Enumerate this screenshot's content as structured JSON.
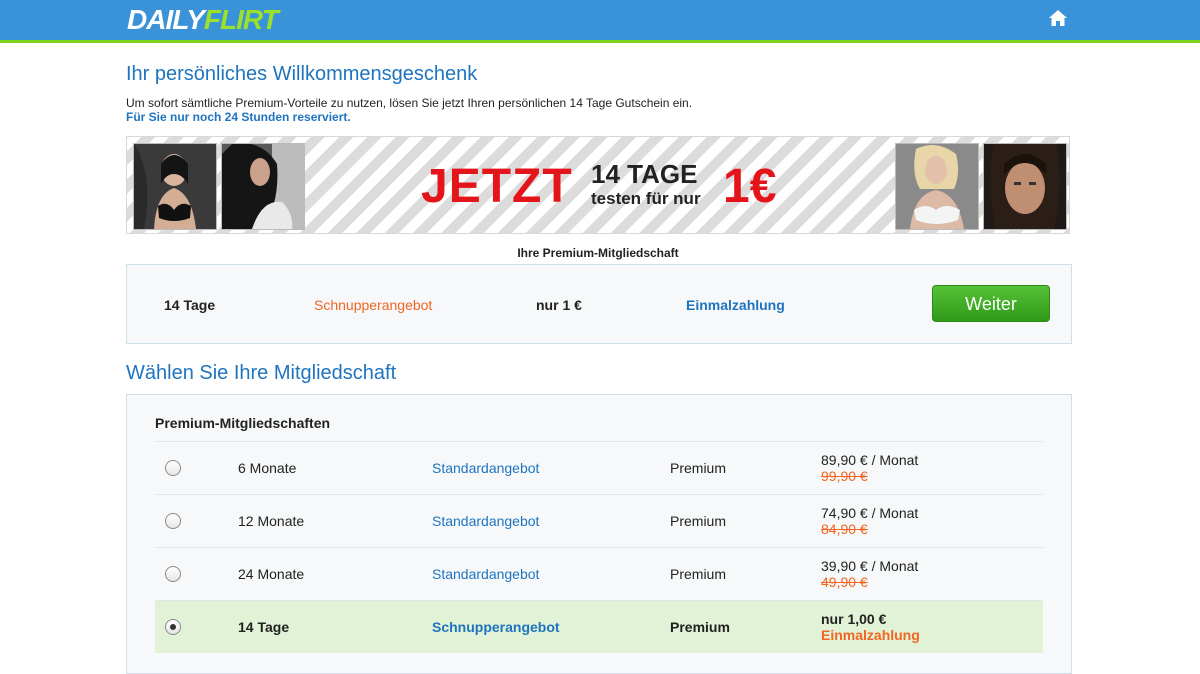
{
  "header": {
    "logo_part1": "DAILY",
    "logo_part2": "FLIRT",
    "home_icon": "home-icon",
    "brand_color": "#3a92d8",
    "accent_color": "#7ed321"
  },
  "welcome": {
    "title": "Ihr persönliches Willkommensgeschenk",
    "text": "Um sofort sämtliche Premium-Vorteile zu nutzen, lösen Sie jetzt Ihren persönlichen 14 Tage Gutschein ein.",
    "reserved": "Für Sie nur noch 24 Stunden reserviert."
  },
  "banner": {
    "jetzt": "JETZT",
    "tage": "14 TAGE",
    "testen": "testen für nur",
    "price": "1€"
  },
  "selected": {
    "section_label": "Ihre Premium-Mitgliedschaft",
    "duration": "14 Tage",
    "offer": "Schnupperangebot",
    "price": "nur 1 €",
    "payment": "Einmalzahlung",
    "button": "Weiter"
  },
  "plans": {
    "title": "Wählen Sie Ihre Mitgliedschaft",
    "subtitle": "Premium-Mitgliedschaften",
    "rows": [
      {
        "duration": "6 Monate",
        "offer": "Standardangebot",
        "type": "Premium",
        "price": "89,90 € / Monat",
        "old_price": "99,90 €",
        "selected": false
      },
      {
        "duration": "12 Monate",
        "offer": "Standardangebot",
        "type": "Premium",
        "price": "74,90 € / Monat",
        "old_price": "84,90 €",
        "selected": false
      },
      {
        "duration": "24 Monate",
        "offer": "Standardangebot",
        "type": "Premium",
        "price": "39,90 € / Monat",
        "old_price": "49,90 €",
        "selected": false
      },
      {
        "duration": "14 Tage",
        "offer": "Schnupperangebot",
        "type": "Premium",
        "price": "nur 1,00 €",
        "old_price": "Einmalzahlung",
        "selected": true
      }
    ]
  }
}
